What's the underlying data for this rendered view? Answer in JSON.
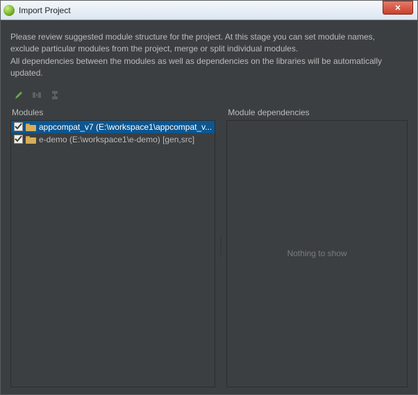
{
  "window": {
    "title": "Import Project",
    "close_glyph": "✕"
  },
  "instructions": {
    "line1": "Please review suggested module structure for the project. At this stage you can set module names,",
    "line2": "exclude particular modules from the project, merge or split individual modules.",
    "line3": "All dependencies between the modules as well as dependencies on the libraries will be automatically updated."
  },
  "toolbar": {
    "rename": "Rename module",
    "split": "Split module",
    "merge": "Merge modules"
  },
  "panels": {
    "modules_title": "Modules",
    "dependencies_title": "Module dependencies",
    "empty_text": "Nothing to show"
  },
  "modules": [
    {
      "checked": true,
      "selected": true,
      "label": "appcompat_v7 (E:\\workspace1\\appcompat_v..."
    },
    {
      "checked": true,
      "selected": false,
      "label": "e-demo (E:\\workspace1\\e-demo) [gen,src]"
    }
  ]
}
